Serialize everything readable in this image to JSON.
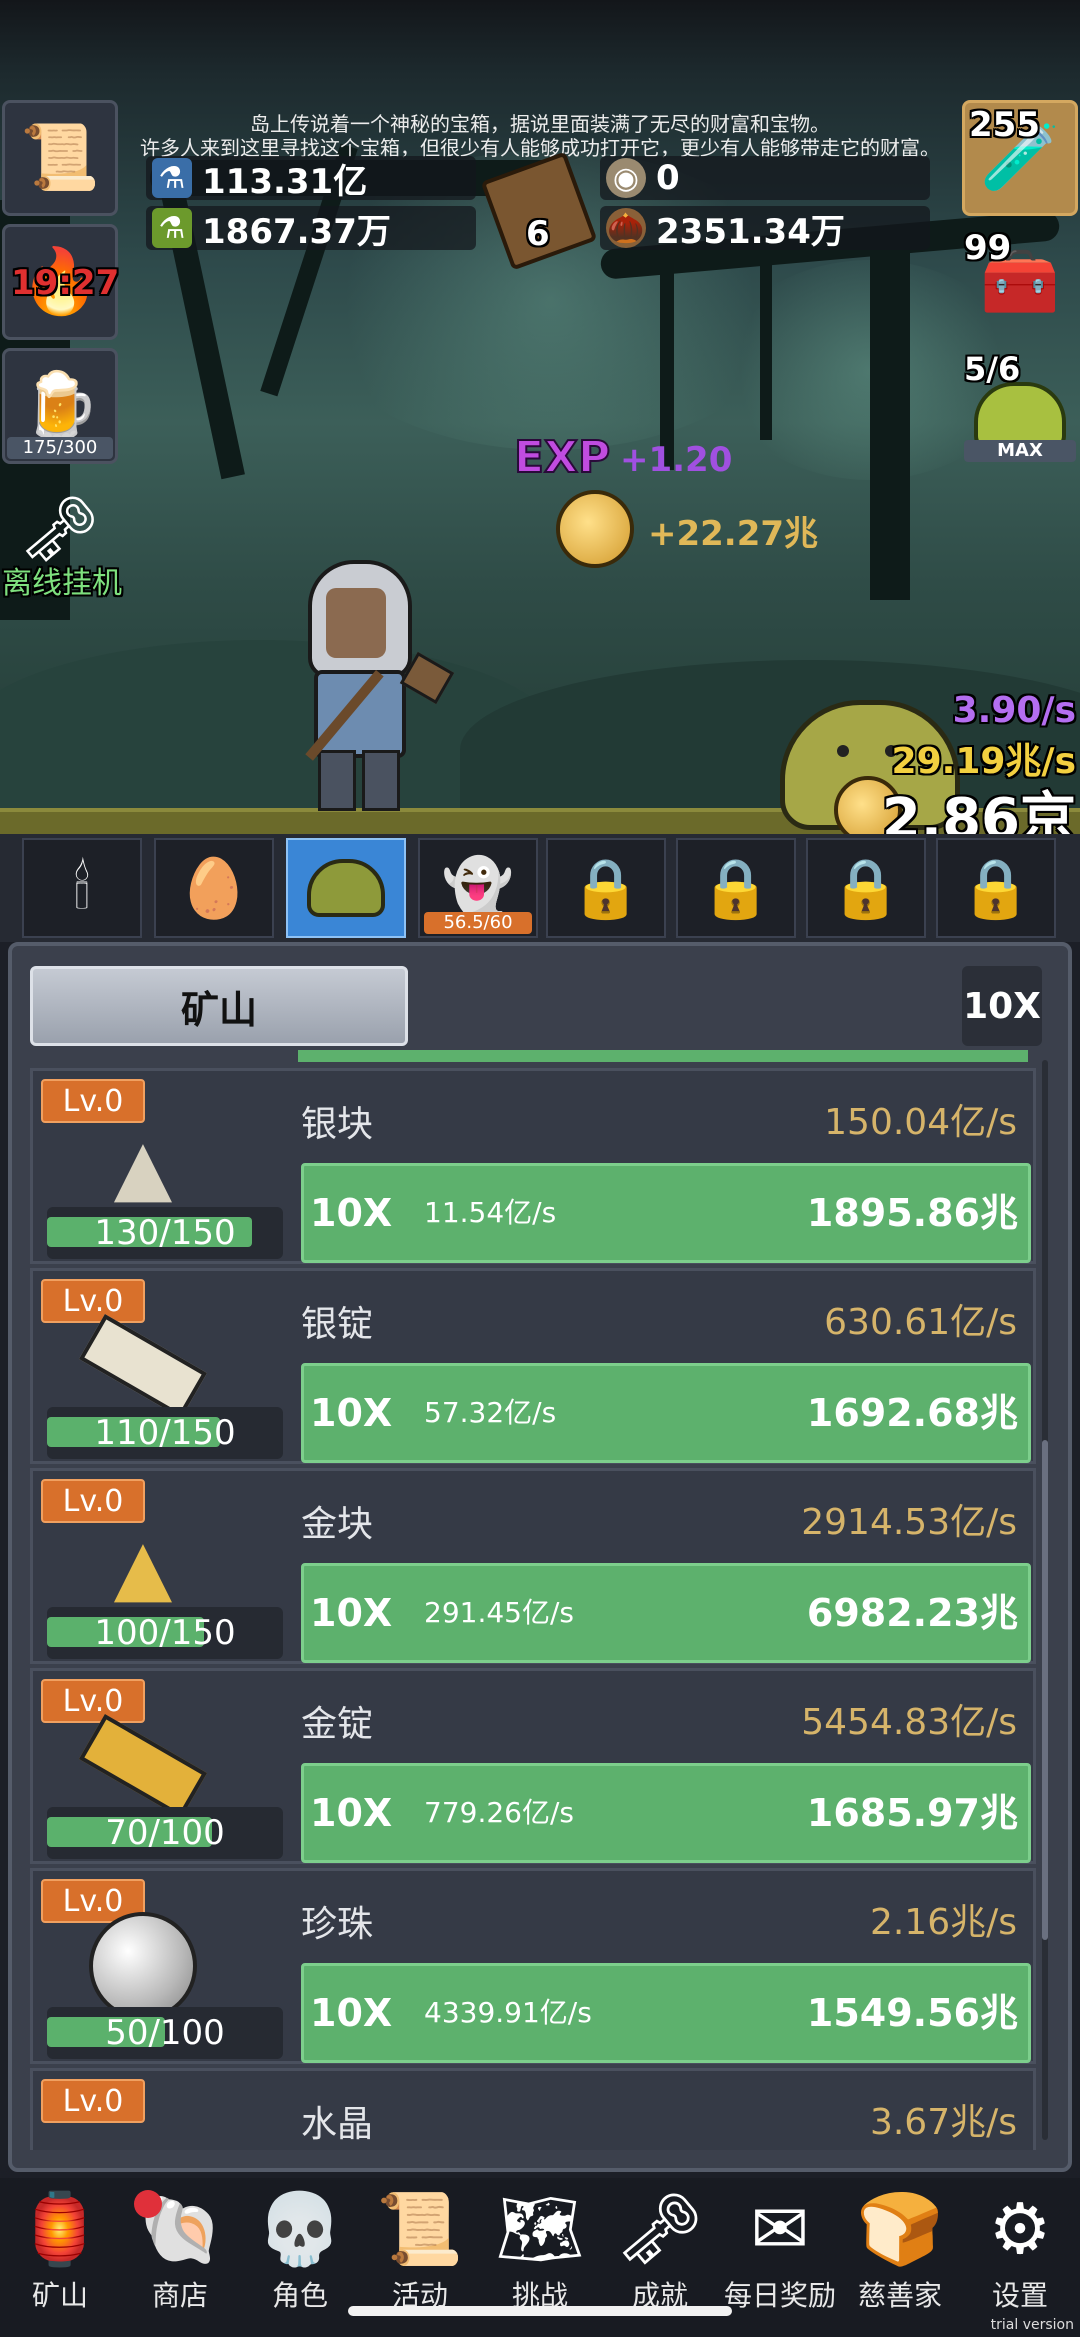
{
  "story": {
    "line1": "岛上传说着一个神秘的宝箱，据说里面装满了无尽的财富和宝物。",
    "line2": "许多人来到这里寻找这个宝箱，但很少有人能够成功打开它，更少有人能够带走它的财富。"
  },
  "resources": {
    "blue_potion": "113.31亿",
    "green_potion": "1867.37万",
    "book_count": "6",
    "coin_small": "0",
    "seed": "2351.34万"
  },
  "left_side": {
    "timer": "19:27",
    "beer_progress": "175/300",
    "offline_label": "离线挂机"
  },
  "right_side": {
    "potion_count": "255",
    "chest_count": "99",
    "slime_count": "5/6",
    "slime_badge": "MAX"
  },
  "floating": {
    "exp_label": "EXP",
    "exp_gain": "+1.20",
    "coin_gain": "+22.27兆"
  },
  "rates": {
    "exp_rate": "3.90/s",
    "coin_rate": "29.19兆/s",
    "total_coins": "2.86京"
  },
  "character_slots": {
    "ghost_progress": "56.5/60"
  },
  "panel": {
    "tab_label": "矿山",
    "multiplier": "10X"
  },
  "items": [
    {
      "level": "Lv.0",
      "name": "银块",
      "rate": "150.04亿/s",
      "progress_text": "130/150",
      "progress": 0.867,
      "mult": "10X",
      "increase": "11.54亿/s",
      "cost": "1895.86兆",
      "icon": "silver-nugget-icon"
    },
    {
      "level": "Lv.0",
      "name": "银锭",
      "rate": "630.61亿/s",
      "progress_text": "110/150",
      "progress": 0.733,
      "mult": "10X",
      "increase": "57.32亿/s",
      "cost": "1692.68兆",
      "icon": "silver-ingot-icon"
    },
    {
      "level": "Lv.0",
      "name": "金块",
      "rate": "2914.53亿/s",
      "progress_text": "100/150",
      "progress": 0.667,
      "mult": "10X",
      "increase": "291.45亿/s",
      "cost": "6982.23兆",
      "icon": "gold-nugget-icon"
    },
    {
      "level": "Lv.0",
      "name": "金锭",
      "rate": "5454.83亿/s",
      "progress_text": "70/100",
      "progress": 0.7,
      "mult": "10X",
      "increase": "779.26亿/s",
      "cost": "1685.97兆",
      "icon": "gold-ingot-icon"
    },
    {
      "level": "Lv.0",
      "name": "珍珠",
      "rate": "2.16兆/s",
      "progress_text": "50/100",
      "progress": 0.5,
      "mult": "10X",
      "increase": "4339.91亿/s",
      "cost": "1549.56兆",
      "icon": "pearl-icon"
    },
    {
      "level": "Lv.0",
      "name": "水晶",
      "rate": "3.67兆/s",
      "icon": "crystal-icon"
    }
  ],
  "nav": [
    "矿山",
    "商店",
    "角色",
    "活动",
    "挑战",
    "成就",
    "每日奖励",
    "慈善家",
    "设置"
  ],
  "watermark": "trial version"
}
